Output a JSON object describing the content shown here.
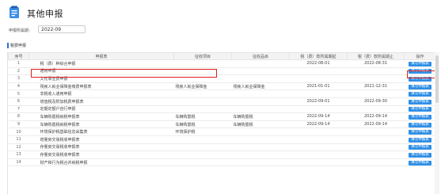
{
  "header": {
    "title": "其他申报",
    "logo_icon": "declaration-form-icon"
  },
  "period": {
    "label": "申报所属期：",
    "value": "2022-09"
  },
  "section": {
    "title": "税费申报"
  },
  "table": {
    "columns": [
      "序号",
      "申报表",
      "征收项目",
      "征收品目",
      "税（费）款所属期起",
      "税（费）款所属期止",
      "操作"
    ],
    "rows": [
      {
        "no": "1",
        "name": "税（费）种综合申报",
        "item": "",
        "sub": "",
        "start": "2022-08-01",
        "end": "2022-08-31",
        "action": "填写申报表"
      },
      {
        "no": "2",
        "name": "通用申报",
        "item": "",
        "sub": "",
        "start": "",
        "end": "",
        "action": "填写申报表"
      },
      {
        "no": "3",
        "name": "文化事业费申报",
        "item": "",
        "sub": "",
        "start": "",
        "end": "",
        "action": "填写申报表"
      },
      {
        "no": "4",
        "name": "残疾人就业保障金缴费申报表",
        "item": "残疾人就业保障金",
        "sub": "残疾人就业保障金",
        "start": "2021-01-01",
        "end": "2021-12-31",
        "action": "填写申报表"
      },
      {
        "no": "5",
        "name": "非税收入通用申报",
        "item": "",
        "sub": "",
        "start": "",
        "end": "",
        "action": "填写申报表"
      },
      {
        "no": "6",
        "name": "增值税及附加税费申报表",
        "item": "",
        "sub": "",
        "start": "2022-09-01",
        "end": "2022-09-30",
        "action": "填写申报表"
      },
      {
        "no": "7",
        "name": "定期定额户自行申报",
        "item": "",
        "sub": "",
        "start": "",
        "end": "",
        "action": "填写申报表"
      },
      {
        "no": "8",
        "name": "车辆购置税纳税申报表",
        "item": "车辆购置税",
        "sub": "车辆购置税",
        "start": "2022-09-14",
        "end": "2022-09-14",
        "action": "填写申报表"
      },
      {
        "no": "9",
        "name": "车辆购置税纳税申报表",
        "item": "车辆购置税",
        "sub": "车辆购置税",
        "start": "2022-09-14",
        "end": "2022-09-14",
        "action": "填写申报表"
      },
      {
        "no": "10",
        "name": "环境保护税基础信息采集表",
        "item": "环境保护税",
        "sub": "",
        "start": "",
        "end": "",
        "action": "填写申报表"
      },
      {
        "no": "11",
        "name": "增量房交易税收申报表",
        "item": "",
        "sub": "",
        "start": "",
        "end": "",
        "action": "填写申报表"
      },
      {
        "no": "12",
        "name": "存量房交易税收申报表",
        "item": "",
        "sub": "",
        "start": "",
        "end": "",
        "action": "填写申报表"
      },
      {
        "no": "13",
        "name": "存量房交易税收申报表",
        "item": "",
        "sub": "",
        "start": "",
        "end": "",
        "action": "填写申报表"
      },
      {
        "no": "14",
        "name": "财产和行为税合并纳税申报",
        "item": "",
        "sub": "",
        "start": "",
        "end": "",
        "action": "填写申报表"
      }
    ]
  },
  "colors": {
    "accent": "#2f8fe6",
    "highlight": "#e02020",
    "header_bg": "#f3f3f3"
  }
}
